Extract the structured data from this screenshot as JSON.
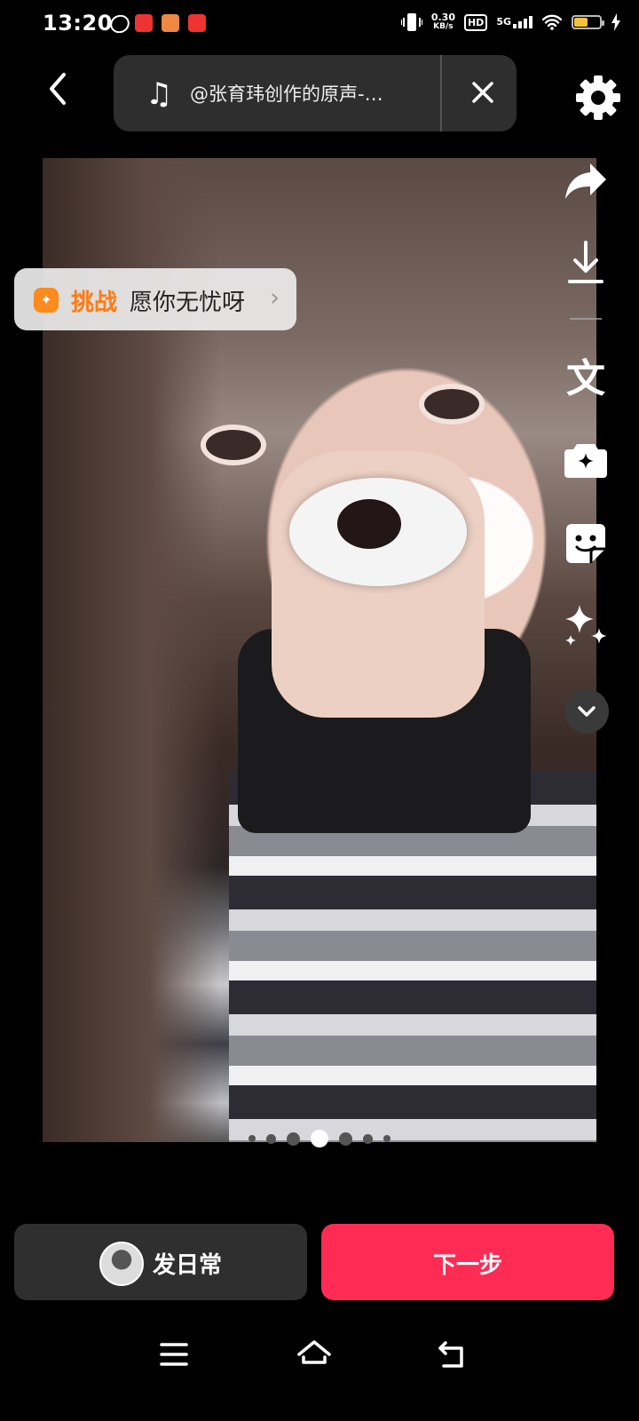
{
  "status_bar": {
    "time": "13:20",
    "net_speed_value": "0.30",
    "net_speed_unit": "KB/s",
    "hd": "HD",
    "network": "5G",
    "battery_level": 0.55
  },
  "top_bar": {
    "music_text": "@张育玮创作的原声-…",
    "icons": {
      "back": "back-arrow-icon",
      "music": "music-note-icon",
      "close": "close-icon",
      "settings": "gear-icon"
    }
  },
  "challenge": {
    "tag": "挑战",
    "title": "愿你无忧呀",
    "icon": "sparkle-badge-icon"
  },
  "tools": {
    "text_label": "文",
    "icons": [
      "share-arrow-icon",
      "download-icon",
      "text-icon",
      "ai-camera-icon",
      "sticker-icon",
      "effects-sparkle-icon",
      "chevron-down-icon"
    ]
  },
  "pager": {
    "count": 7,
    "active_index": 3
  },
  "actions": {
    "daily_label": "发日常",
    "next_label": "下一步"
  },
  "colors": {
    "accent": "#fe2c55",
    "challenge_orange": "#ff7a12",
    "panel": "#2f2f2f"
  }
}
